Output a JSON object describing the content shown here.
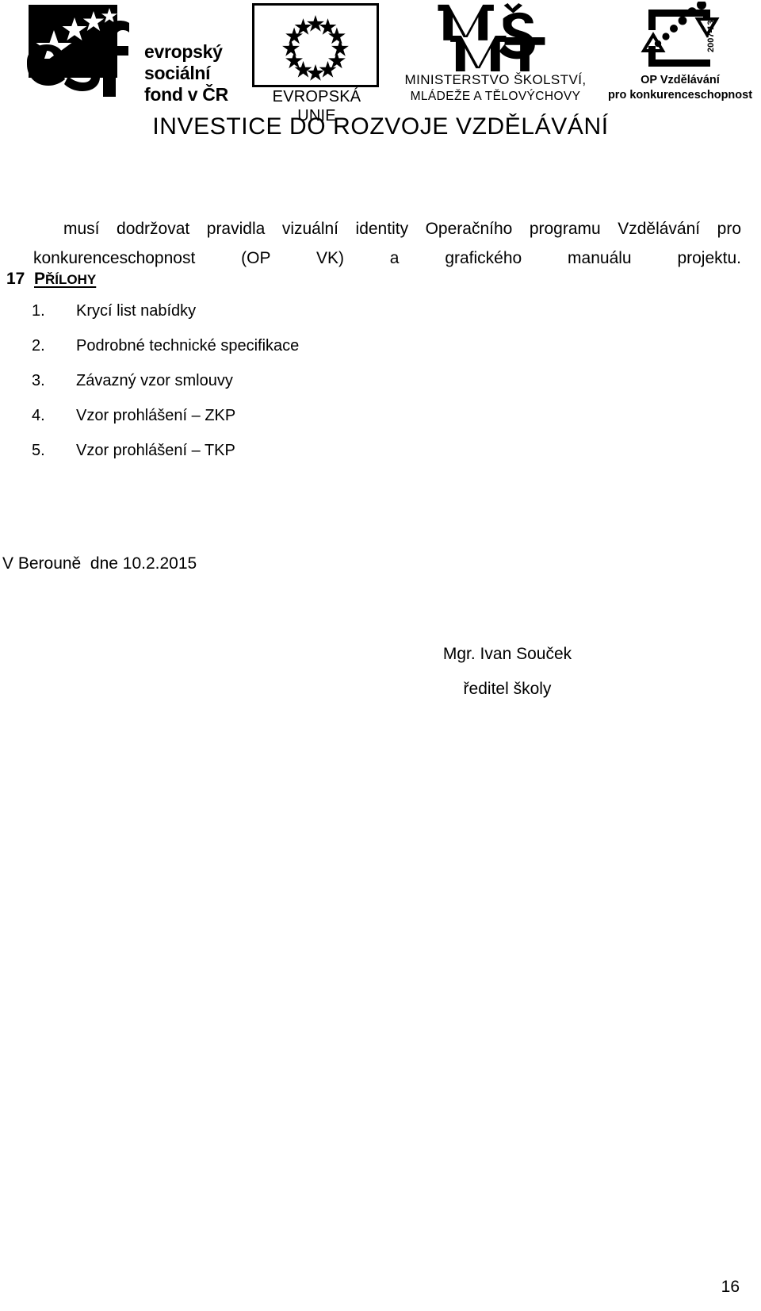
{
  "header": {
    "esf_logo": {
      "icon": "esf-stars-logo",
      "line1": "evropský",
      "line2": "sociální",
      "line3": "fond v ČR"
    },
    "eu_logo": {
      "icon": "eu-flag-stars-icon",
      "caption": "EVROPSKÁ UNIE"
    },
    "msmt_logo": {
      "icon": "msmt-monogram-icon",
      "caption_line1": "MINISTERSTVO ŠKOLSTVÍ,",
      "caption_line2": "MLÁDEŽE A TĚLOVÝCHOVY"
    },
    "opvk_logo": {
      "icon": "op-vzdelavani-bracket-icon",
      "years": "2007-13",
      "caption_line1": "OP Vzdělávání",
      "caption_line2": "pro konkurenceschopnost"
    },
    "slogan": "INVESTICE DO ROZVOJE VZDĚLÁVÁNÍ"
  },
  "content": {
    "paragraph_line1": "musí dodržovat pravidla vizuální identity Operačního programu Vzdělávání pro",
    "paragraph_line2": "konkurenceschopnost (OP VK) a grafického manuálu projektu.",
    "section": {
      "number": "17",
      "title_first_letter": "P",
      "title_rest": "ŘÍLOHY"
    },
    "attachments": [
      {
        "number": "1.",
        "label": "Krycí list nabídky"
      },
      {
        "number": "2.",
        "label": "Podrobné technické specifikace"
      },
      {
        "number": "3.",
        "label": "Závazný vzor smlouvy"
      },
      {
        "number": "4.",
        "label": "Vzor prohlášení – ZKP"
      },
      {
        "number": "5.",
        "label": "Vzor prohlášení – TKP"
      }
    ],
    "date_line": "V Berouně  dne 10.2.2015",
    "signature": {
      "name": "Mgr. Ivan Souček",
      "role": "ředitel školy"
    }
  },
  "footer": {
    "page_number": "16"
  },
  "colors": {
    "ink": "#000000",
    "page": "#ffffff"
  }
}
